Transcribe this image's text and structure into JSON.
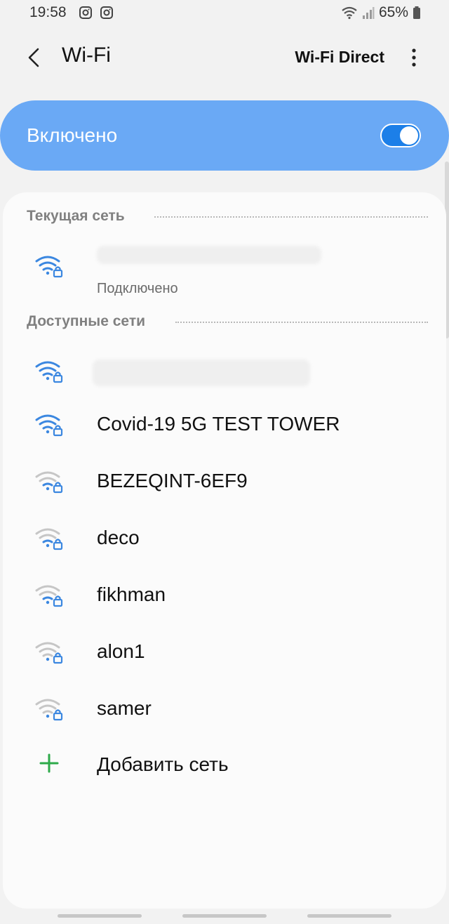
{
  "status_bar": {
    "time": "19:58",
    "battery_text": "65%",
    "icons": [
      "instagram-icon",
      "instagram-icon",
      "wifi-status-icon",
      "signal-icon",
      "battery-icon"
    ]
  },
  "header": {
    "title": "Wi-Fi",
    "wifi_direct_label": "Wi-Fi Direct"
  },
  "toggle": {
    "label": "Включено",
    "enabled": true
  },
  "sections": {
    "current": {
      "heading": "Текущая сеть",
      "networks": [
        {
          "name": "",
          "status": "Подключено",
          "signal": "strong",
          "secured": true
        }
      ]
    },
    "available": {
      "heading": "Доступные сети",
      "networks": [
        {
          "name": "",
          "signal": "strong",
          "secured": true
        },
        {
          "name": "Covid-19 5G TEST TOWER",
          "signal": "strong",
          "secured": true
        },
        {
          "name": "BEZEQINT-6EF9",
          "signal": "weak",
          "secured": true
        },
        {
          "name": "deco",
          "signal": "weak",
          "secured": true
        },
        {
          "name": "fikhman",
          "signal": "weak",
          "secured": true
        },
        {
          "name": "alon1",
          "signal": "weak",
          "secured": true
        },
        {
          "name": "samer",
          "signal": "weak",
          "secured": true
        }
      ]
    }
  },
  "add_network": {
    "label": "Добавить сеть"
  },
  "colors": {
    "toggle_bg": "#6aa9f5",
    "wifi_strong": "#3b87e0",
    "wifi_weak": "#c6c6c6",
    "add_icon": "#2eaa4a"
  }
}
